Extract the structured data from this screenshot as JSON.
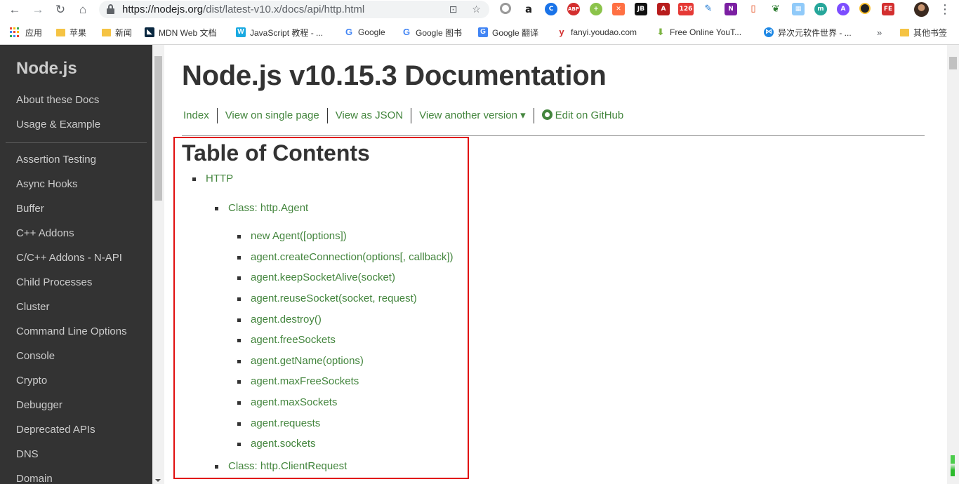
{
  "browser": {
    "url_host": "https://nodejs.org",
    "url_path": "/dist/latest-v10.x/docs/api/http.html",
    "bookmarks": [
      {
        "label": "应用",
        "icon": "apps-grid-icon"
      },
      {
        "label": "苹果",
        "icon": "folder-icon"
      },
      {
        "label": "新闻",
        "icon": "folder-icon"
      },
      {
        "label": "MDN Web 文档",
        "icon": "mdn-icon"
      },
      {
        "label": "JavaScript 教程 - ...",
        "icon": "w3school-icon"
      },
      {
        "label": "Google",
        "icon": "google-icon"
      },
      {
        "label": "Google 图书",
        "icon": "google-icon"
      },
      {
        "label": "Google 翻译",
        "icon": "google-translate-icon"
      },
      {
        "label": "fanyi.youdao.com",
        "icon": "youdao-icon"
      },
      {
        "label": "Free Online YouT...",
        "icon": "download-icon"
      },
      {
        "label": "异次元软件世界 - ...",
        "icon": "iplaysoft-icon"
      },
      {
        "label": "其他书签",
        "icon": "folder-icon"
      }
    ],
    "overflow_label": "»"
  },
  "sidebar": {
    "logo": "Node.js",
    "top_links": [
      "About these Docs",
      "Usage & Example"
    ],
    "links": [
      "Assertion Testing",
      "Async Hooks",
      "Buffer",
      "C++ Addons",
      "C/C++ Addons - N-API",
      "Child Processes",
      "Cluster",
      "Command Line Options",
      "Console",
      "Crypto",
      "Debugger",
      "Deprecated APIs",
      "DNS",
      "Domain"
    ]
  },
  "main": {
    "title": "Node.js v10.15.3 Documentation",
    "nav": [
      "Index",
      "View on single page",
      "View as JSON",
      "View another version ▾",
      "Edit on GitHub"
    ],
    "toc_title": "Table of Contents",
    "toc": [
      {
        "label": "HTTP",
        "level": 1
      },
      {
        "label": "Class: http.Agent",
        "level": 2
      },
      {
        "label": "new Agent([options])",
        "level": 3
      },
      {
        "label": "agent.createConnection(options[, callback])",
        "level": 3
      },
      {
        "label": "agent.keepSocketAlive(socket)",
        "level": 3
      },
      {
        "label": "agent.reuseSocket(socket, request)",
        "level": 3
      },
      {
        "label": "agent.destroy()",
        "level": 3
      },
      {
        "label": "agent.freeSockets",
        "level": 3
      },
      {
        "label": "agent.getName(options)",
        "level": 3
      },
      {
        "label": "agent.maxFreeSockets",
        "level": 3
      },
      {
        "label": "agent.maxSockets",
        "level": 3
      },
      {
        "label": "agent.requests",
        "level": 3
      },
      {
        "label": "agent.sockets",
        "level": 3
      },
      {
        "label": "Class: http.ClientRequest",
        "level": 2
      }
    ]
  },
  "colors": {
    "link_green": "#43853d",
    "sidebar_bg": "#333333",
    "highlight_border": "#e10e0e"
  }
}
